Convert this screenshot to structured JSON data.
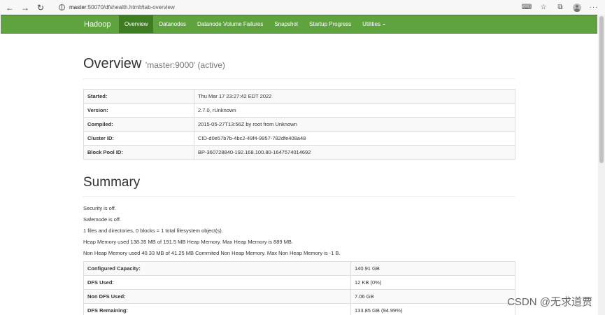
{
  "browser": {
    "url_host": "master",
    "url_rest": ":50070/dfshealth.html#tab-overview"
  },
  "navbar": {
    "brand": "Hadoop",
    "items": [
      {
        "label": "Overview",
        "active": true
      },
      {
        "label": "Datanodes"
      },
      {
        "label": "Datanode Volume Failures"
      },
      {
        "label": "Snapshot"
      },
      {
        "label": "Startup Progress"
      },
      {
        "label": "Utilities"
      }
    ]
  },
  "overview": {
    "title": "Overview",
    "subtitle": "'master:9000' (active)",
    "rows": [
      {
        "key": "Started:",
        "value": "Thu Mar 17 23:27:42 EDT 2022"
      },
      {
        "key": "Version:",
        "value": "2.7.0, rUnknown"
      },
      {
        "key": "Compiled:",
        "value": "2015-05-27T13:56Z by root from Unknown"
      },
      {
        "key": "Cluster ID:",
        "value": "CID-d0e57b7b-4bc2-49f4-9957-782dfe408a48"
      },
      {
        "key": "Block Pool ID:",
        "value": "BP-360728840-192.168.100.80-1647574014692"
      }
    ]
  },
  "summary": {
    "title": "Summary",
    "lines": [
      "Security is off.",
      "Safemode is off.",
      "1 files and directories, 0 blocks = 1 total filesystem object(s).",
      "Heap Memory used 138.35 MB of 191.5 MB Heap Memory. Max Heap Memory is 889 MB.",
      "Non Heap Memory used 40.33 MB of 41.25 MB Commited Non Heap Memory. Max Non Heap Memory is -1 B."
    ],
    "rows": [
      {
        "key": "Configured Capacity:",
        "value": "140.91 GB"
      },
      {
        "key": "DFS Used:",
        "value": "12 KB (0%)"
      },
      {
        "key": "Non DFS Used:",
        "value": "7.06 GB"
      },
      {
        "key": "DFS Remaining:",
        "value": "133.85 GB (94.99%)"
      }
    ]
  },
  "watermark": "CSDN @无求道贾"
}
